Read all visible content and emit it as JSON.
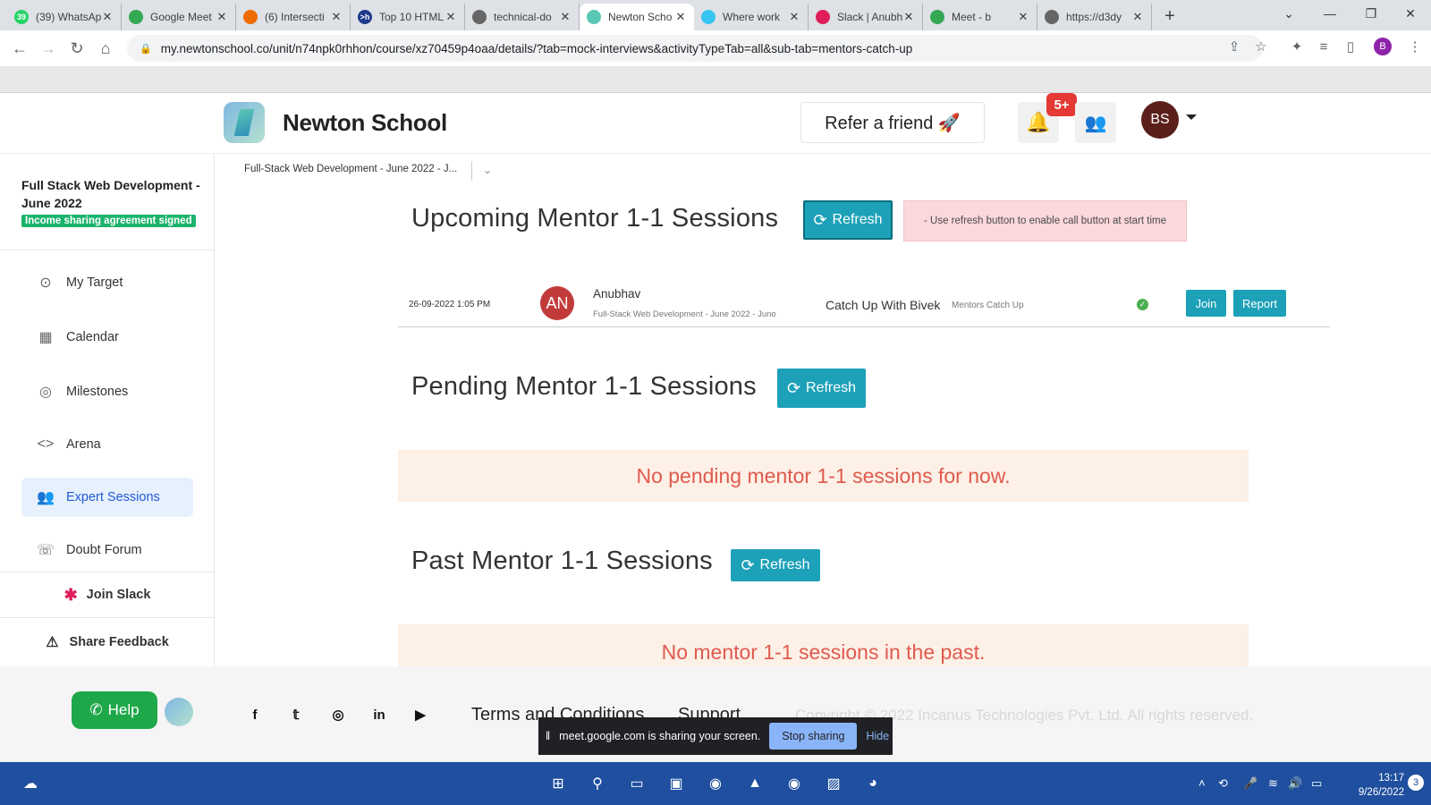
{
  "browser": {
    "tabs": [
      {
        "title": "(39) WhatsApp",
        "fav": "39",
        "color": "#25d366"
      },
      {
        "title": "Google Meet",
        "fav": "",
        "color": "#34a853"
      },
      {
        "title": "(6) Intersecti",
        "fav": "",
        "color": "#ef6c00"
      },
      {
        "title": "Top 10 HTML",
        "fav": ">h",
        "color": "#1e3a8a"
      },
      {
        "title": "technical-do",
        "fav": "",
        "color": "#666"
      },
      {
        "title": "Newton Scho",
        "fav": "",
        "color": "#5bc7b5"
      },
      {
        "title": "Where work",
        "fav": "",
        "color": "#36c5f0"
      },
      {
        "title": "Slack | Anubh",
        "fav": "",
        "color": "#e01e5a"
      },
      {
        "title": "Meet - b",
        "fav": "",
        "color": "#34a853"
      },
      {
        "title": "https://d3dy",
        "fav": "",
        "color": "#666"
      }
    ],
    "url": "my.newtonschool.co/unit/n74npk0rhhon/course/xz70459p4oaa/details/?tab=mock-interviews&activityTypeTab=all&sub-tab=mentors-catch-up",
    "profile_initial": "B"
  },
  "header": {
    "brand": "Newton School",
    "refer": "Refer a friend 🚀",
    "notif_badge": "5+",
    "avatar": "BS"
  },
  "sidebar": {
    "course": "Full Stack Web Development - June 2022",
    "isa": "Income sharing agreement signed",
    "items": [
      {
        "label": "My Target",
        "icon": "⊙"
      },
      {
        "label": "Calendar",
        "icon": "▦"
      },
      {
        "label": "Milestones",
        "icon": "◎"
      },
      {
        "label": "Arena",
        "icon": "<>"
      },
      {
        "label": "Expert Sessions",
        "icon": "👥"
      },
      {
        "label": "Doubt Forum",
        "icon": "☏"
      }
    ],
    "slack": "Join Slack",
    "feedback": "Share Feedback"
  },
  "breadcrumb": "Full-Stack Web Development - June 2022 - J...",
  "main": {
    "upcoming_title": "Upcoming Mentor 1-1 Sessions",
    "pending_title": "Pending Mentor 1-1 Sessions",
    "past_title": "Past Mentor 1-1 Sessions",
    "refresh": "Refresh",
    "notice": "- Use refresh button to enable call button at start time",
    "session": {
      "datetime": "26-09-2022 1:05 PM",
      "avatar": "AN",
      "mentor": "Anubhav",
      "course": "Full-Stack Web Development - June 2022 - Juno",
      "title": "Catch Up With Bivek",
      "type": "Mentors Catch Up",
      "join": "Join",
      "report": "Report"
    },
    "pending_empty": "No pending mentor 1-1 sessions for now.",
    "past_empty": "No mentor 1-1 sessions in the past."
  },
  "footer": {
    "help": "Help",
    "terms": "Terms and Conditions",
    "support": "Support",
    "copyright": "Copyright © 2022 Incanus Technologies Pvt. Ltd. All rights reserved."
  },
  "share_bar": {
    "message": "meet.google.com is sharing your screen.",
    "stop": "Stop sharing",
    "hide": "Hide"
  },
  "taskbar": {
    "time": "13:17",
    "date": "9/26/2022",
    "notif_count": "3"
  }
}
